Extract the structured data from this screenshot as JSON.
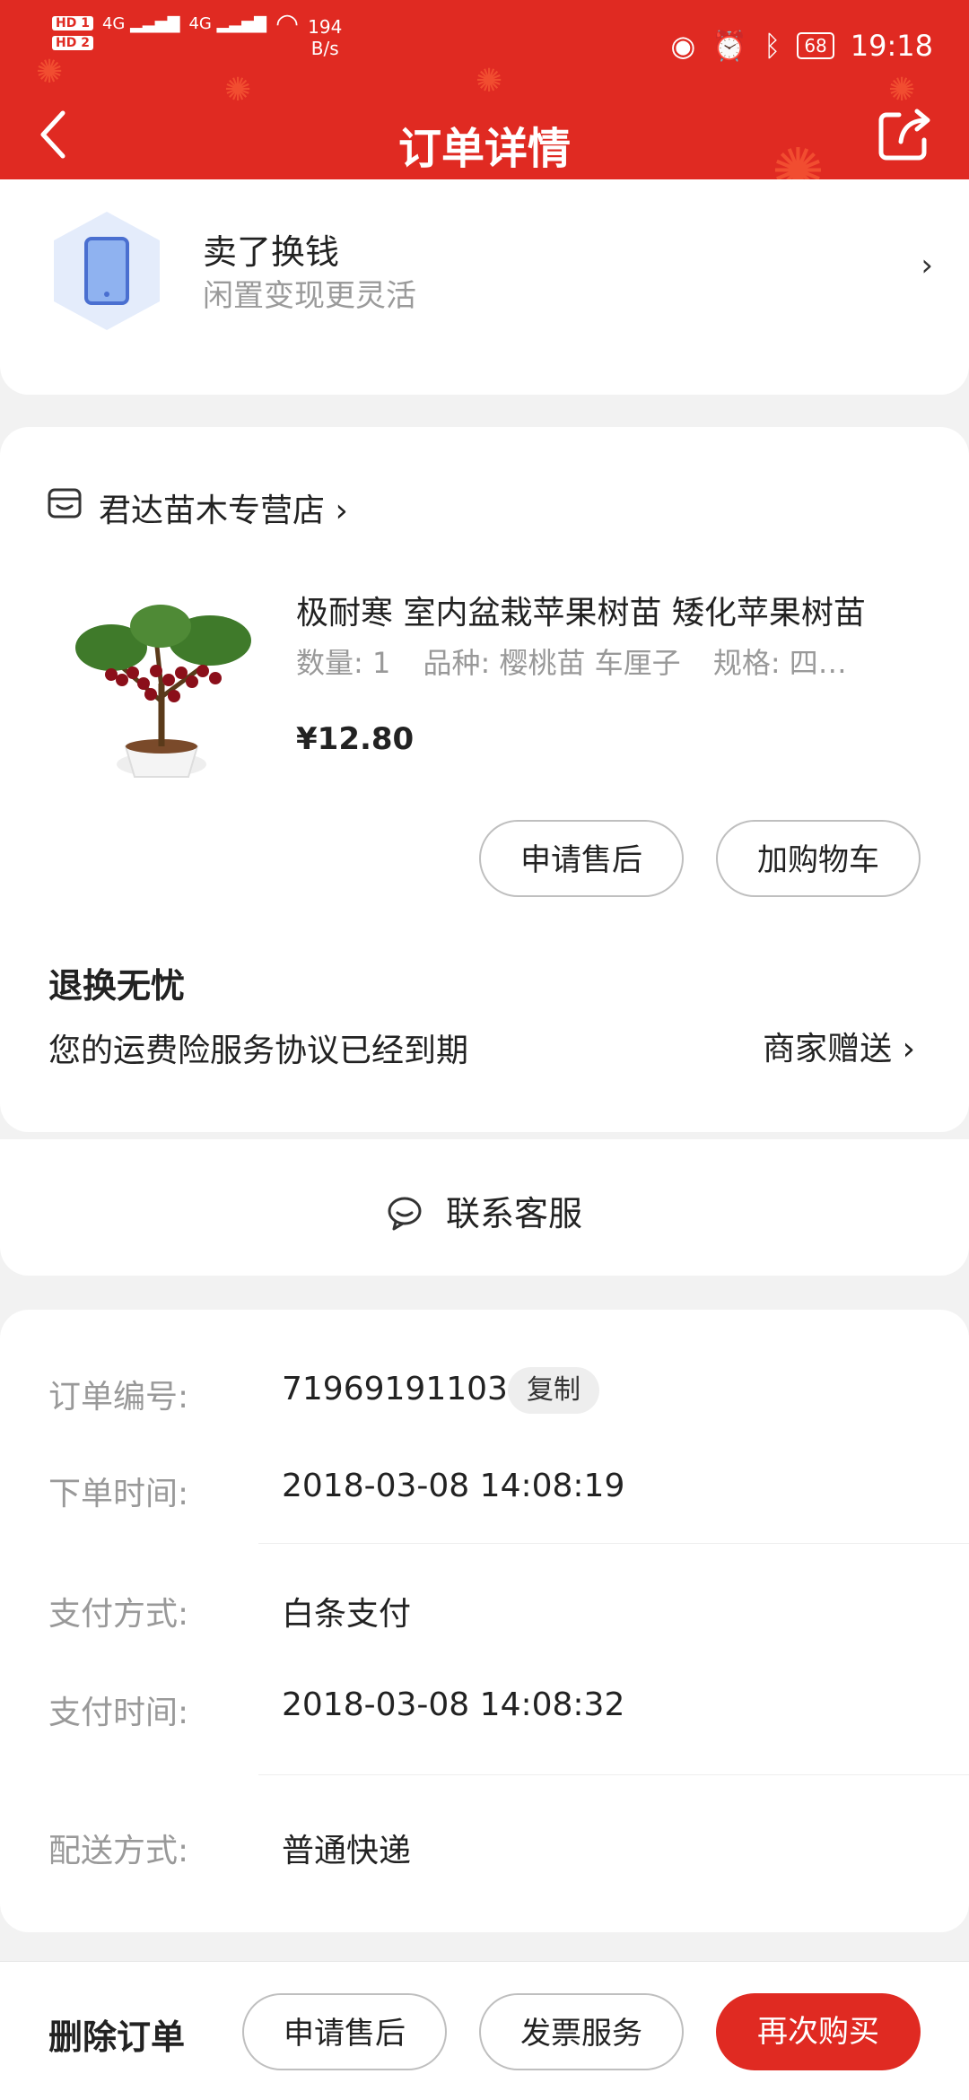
{
  "status_bar": {
    "hd1": "HD 1",
    "hd2": "HD 2",
    "signal1": "4G",
    "signal2": "4G",
    "speed_value": "194",
    "speed_unit": "B/s",
    "battery": "68",
    "time": "19:18"
  },
  "header": {
    "title": "订单详情"
  },
  "sell": {
    "title": "卖了换钱",
    "subtitle": "闲置变现更灵活",
    "chevron": "›"
  },
  "shop": {
    "name": "君达苗木专营店",
    "chevron": "›"
  },
  "product": {
    "title": "极耐寒 室内盆栽苹果树苗 矮化苹果树苗",
    "qty": "数量: 1",
    "variety": "品种: 樱桃苗 车厘子",
    "spec": "规格: 四…",
    "price": "¥12.80",
    "btn_after_sale": "申请售后",
    "btn_add_cart": "加购物车"
  },
  "worry_free": {
    "title": "退换无忧",
    "text": "您的运费险服务协议已经到期",
    "merchant": "商家赠送 ›"
  },
  "service": {
    "label": "联系客服"
  },
  "order_info": {
    "order_no_label": "订单编号:",
    "order_no": "71969191103",
    "copy": "复制",
    "order_time_label": "下单时间:",
    "order_time": "2018-03-08 14:08:19",
    "pay_method_label": "支付方式:",
    "pay_method": "白条支付",
    "pay_time_label": "支付时间:",
    "pay_time": "2018-03-08 14:08:32",
    "delivery_label": "配送方式:",
    "delivery": "普通快递"
  },
  "bottom_bar": {
    "delete": "删除订单",
    "after_sale": "申请售后",
    "invoice": "发票服务",
    "buy_again": "再次购买"
  },
  "colors": {
    "brand_red": "#e02a22",
    "bg": "#f2f2f2"
  }
}
